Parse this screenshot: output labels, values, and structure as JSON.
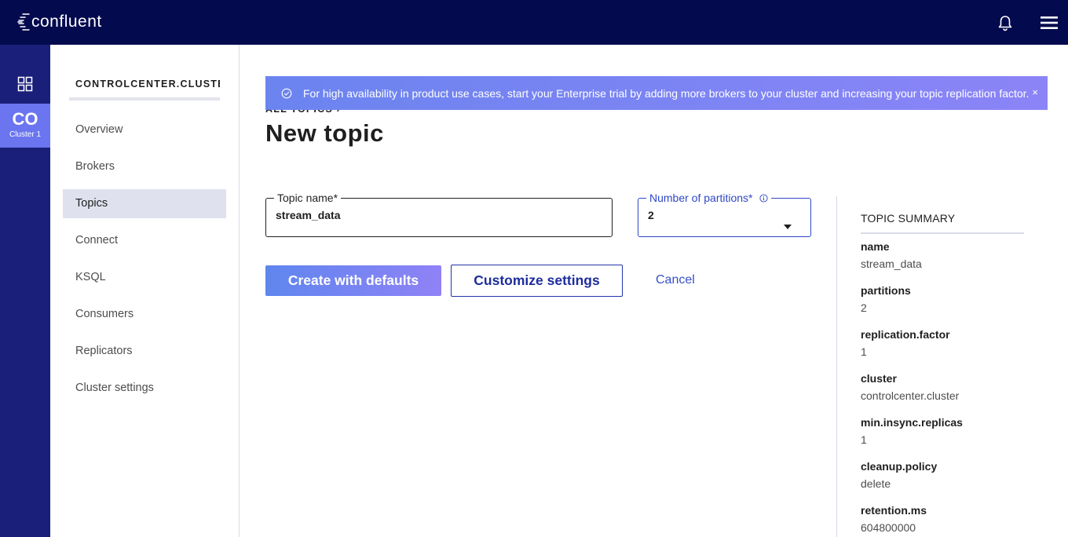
{
  "header": {
    "logo_text": "confluent",
    "icons": [
      "bell-icon",
      "hamburger-menu-icon"
    ],
    "colors": {
      "bg": "#040a4e"
    }
  },
  "rail": {
    "cluster_abbr": "CO",
    "cluster_label": "Cluster 1",
    "icons": [
      "clusters-grid-icon"
    ]
  },
  "sidenav": {
    "cluster_name": "CONTROLCENTER.CLUSTER",
    "items": [
      {
        "label": "Overview"
      },
      {
        "label": "Brokers"
      },
      {
        "label": "Topics",
        "active": true
      },
      {
        "label": "Connect"
      },
      {
        "label": "KSQL"
      },
      {
        "label": "Consumers"
      },
      {
        "label": "Replicators"
      },
      {
        "label": "Cluster settings"
      }
    ]
  },
  "banner": {
    "text": "For high availability in product use cases, start your Enterprise trial by adding more brokers to your cluster and increasing your topic replication factor.",
    "close": "×"
  },
  "breadcrumb": "ALL TOPICS ›",
  "page_title": "New topic",
  "form": {
    "topic_name_label": "Topic name*",
    "topic_name_value": "stream_data",
    "partitions_label": "Number of partitions*",
    "partitions_value": "2"
  },
  "actions": {
    "create_label": "Create with defaults",
    "customize_label": "Customize settings",
    "cancel_label": "Cancel"
  },
  "summary": {
    "title": "TOPIC SUMMARY",
    "fields": [
      {
        "key": "name",
        "value": "stream_data"
      },
      {
        "key": "partitions",
        "value": "2"
      },
      {
        "key": "replication.factor",
        "value": "1"
      },
      {
        "key": "cluster",
        "value": "controlcenter.cluster"
      },
      {
        "key": "min.insync.replicas",
        "value": "1"
      },
      {
        "key": "cleanup.policy",
        "value": "delete"
      },
      {
        "key": "retention.ms",
        "value": "604800000"
      }
    ]
  }
}
